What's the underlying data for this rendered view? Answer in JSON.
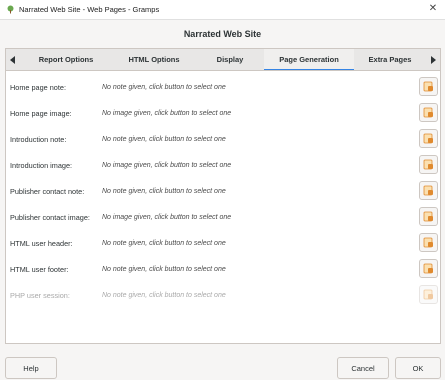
{
  "window": {
    "title": "Narrated Web Site - Web Pages - Gramps",
    "close_symbol": "✕"
  },
  "dialog": {
    "heading": "Narrated Web Site"
  },
  "tabs": [
    {
      "label": "Report Options",
      "active": false
    },
    {
      "label": "HTML Options",
      "active": false
    },
    {
      "label": "Display",
      "active": false
    },
    {
      "label": "Page Generation",
      "active": true
    },
    {
      "label": "Extra Pages",
      "active": false
    }
  ],
  "rows": [
    {
      "label": "Home page note:",
      "value": "No note given, click button to select one",
      "enabled": true
    },
    {
      "label": "Home page image:",
      "value": "No image given, click button to select one",
      "enabled": true
    },
    {
      "label": "Introduction note:",
      "value": "No note given, click button to select one",
      "enabled": true
    },
    {
      "label": "Introduction image:",
      "value": "No image given, click button to select one",
      "enabled": true
    },
    {
      "label": "Publisher contact note:",
      "value": "No note given, click button to select one",
      "enabled": true
    },
    {
      "label": "Publisher contact image:",
      "value": "No image given, click button to select one",
      "enabled": true
    },
    {
      "label": "HTML user header:",
      "value": "No note given, click button to select one",
      "enabled": true
    },
    {
      "label": "HTML user footer:",
      "value": "No note given, click button to select one",
      "enabled": true
    },
    {
      "label": "PHP user session:",
      "value": "No note given, click button to select one",
      "enabled": false
    }
  ],
  "buttons": {
    "help": "Help",
    "cancel": "Cancel",
    "ok": "OK"
  },
  "icons": {
    "app": "gramps-tree-icon",
    "select": "select-object-icon",
    "tab_left": "chevron-left-icon",
    "tab_right": "chevron-right-icon"
  },
  "colors": {
    "accent": "#3584e4",
    "icon_orange": "#e08a2e"
  }
}
